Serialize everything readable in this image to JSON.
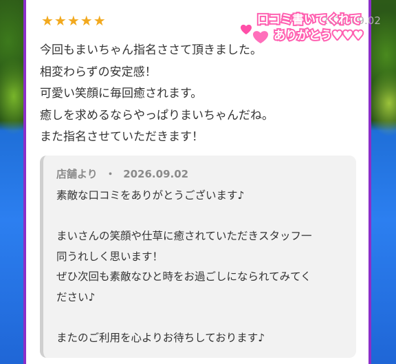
{
  "review": {
    "stars": "★★★★★",
    "date": "2026.09.02",
    "badge_line1": "口コミ書いてくれて",
    "badge_line2": "ありがとう♥♥♥",
    "lines": [
      "今回もまいちゃん指名ささて頂きました。",
      "相変わらずの安定感！",
      "可愛い笑顔に毎回癒されます。",
      "癒しを求めるならやっぱりまいちゃんだね。",
      "また指名させていただきます！"
    ]
  },
  "reply": {
    "author": "店舗より",
    "separator": "・",
    "date": "2026.09.02",
    "lines": [
      "素敵な口コミをありがとうございます♪",
      "",
      "まいさんの笑顔や仕草に癒されていただきスタッフ一",
      "同うれしく思います！",
      "ぜひ次回も素敵なひと時をお過ごしになられてみてく",
      "ださい♪",
      "",
      "またのご利用を心よりお待ちしております♪"
    ]
  },
  "colors": {
    "frame": "#8b2fc9",
    "stars": "#f2a91e",
    "badge_pink": "#ff5fb0"
  }
}
